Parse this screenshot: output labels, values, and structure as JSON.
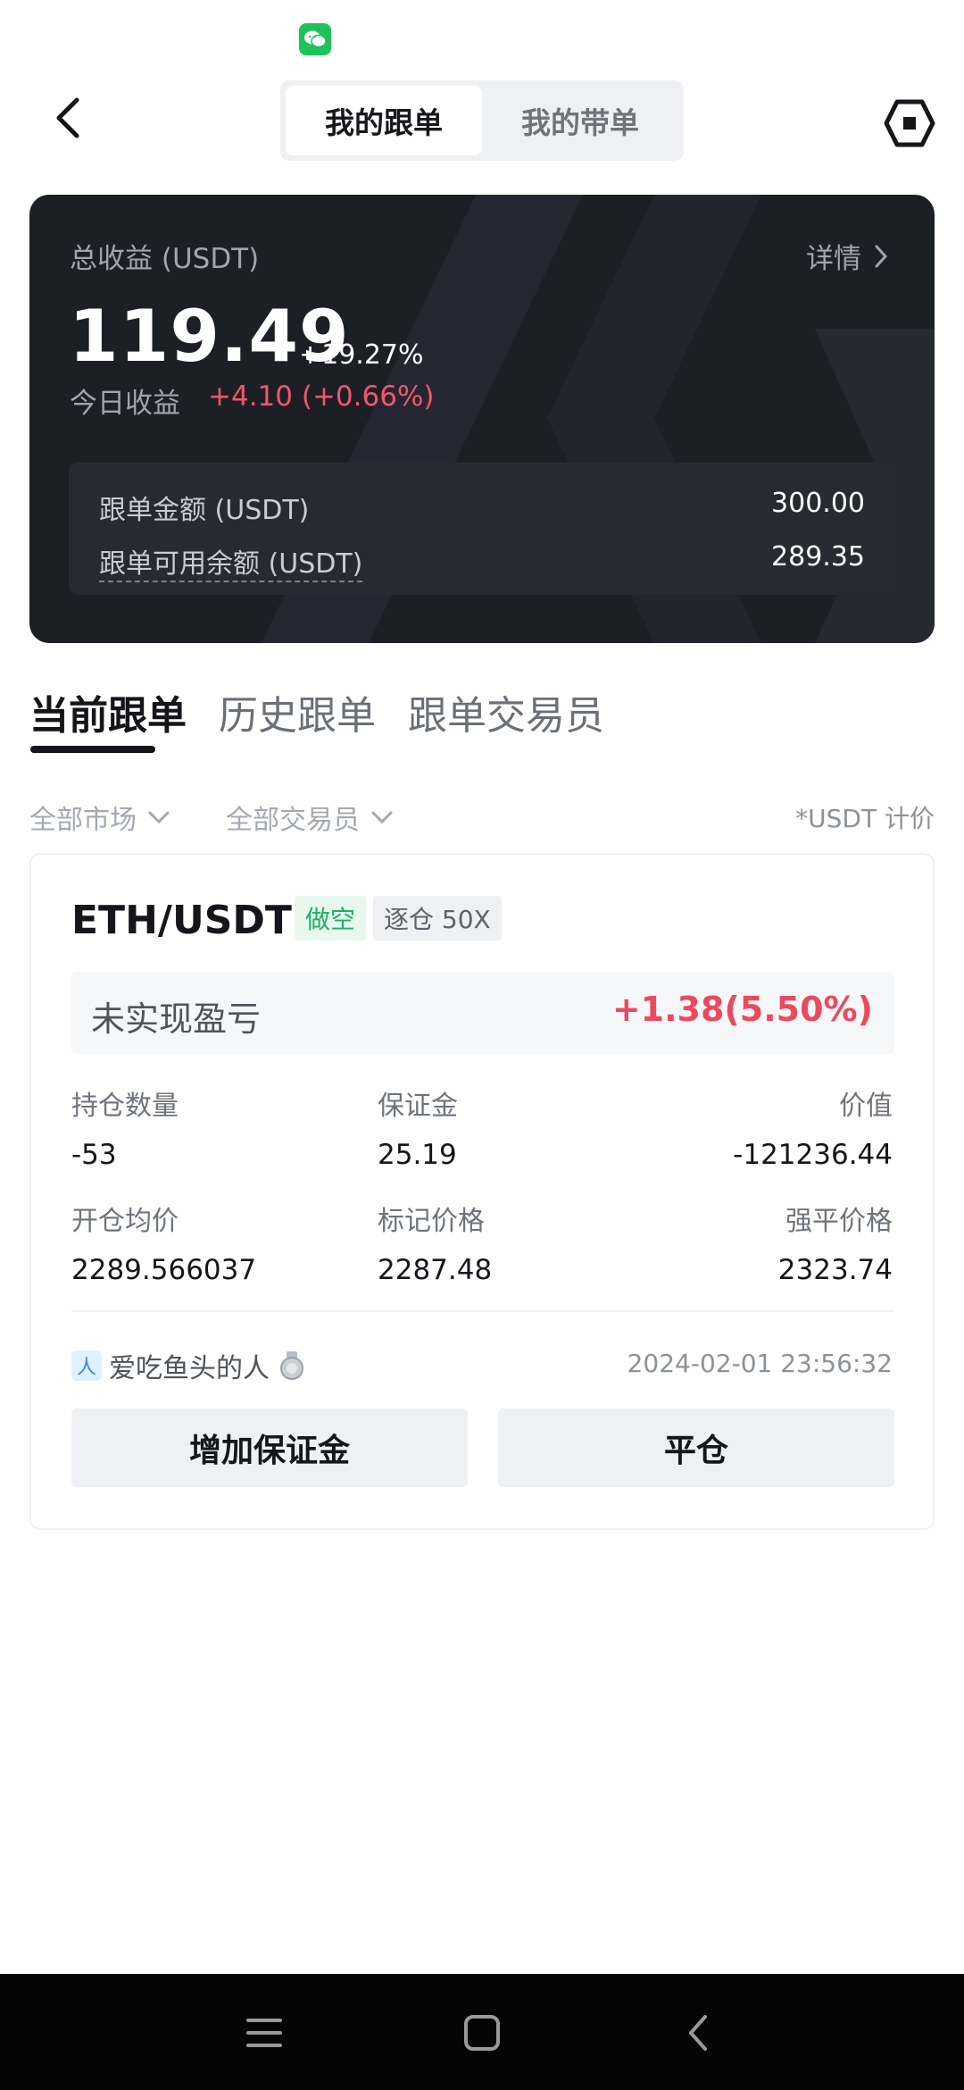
{
  "header": {
    "tabs": [
      {
        "label": "我的跟单",
        "active": true
      },
      {
        "label": "我的带单",
        "active": false
      }
    ]
  },
  "summary": {
    "label": "总收益 (USDT)",
    "detail_label": "详情",
    "total_value": "119.49",
    "total_percent": "+19.27%",
    "today_label": "今日收益",
    "today_value": "+4.10 (+0.66%)",
    "copy_amount_label": "跟单金额 (USDT)",
    "copy_amount_value": "300.00",
    "available_label": "跟单可用余额 (USDT)",
    "available_value": "289.35"
  },
  "tabs": [
    {
      "label": "当前跟单",
      "active": true
    },
    {
      "label": "历史跟单",
      "active": false
    },
    {
      "label": "跟单交易员",
      "active": false
    }
  ],
  "filters": {
    "market": "全部市场",
    "trader": "全部交易员",
    "note": "*USDT 计价"
  },
  "position": {
    "pair": "ETH/USDT",
    "side": "做空",
    "leverage": "逐仓 50X",
    "pnl_label": "未实现盈亏",
    "pnl_value": "+1.38(5.50%)",
    "fields": [
      {
        "label": "持仓数量",
        "value": "-53"
      },
      {
        "label": "保证金",
        "value": "25.19"
      },
      {
        "label": "价值",
        "value": "-121236.44"
      },
      {
        "label": "开仓均价",
        "value": "2289.566037"
      },
      {
        "label": "标记价格",
        "value": "2287.48"
      },
      {
        "label": "强平价格",
        "value": "2323.74"
      }
    ],
    "trader_name": "爱吃鱼头的人",
    "timestamp": "2024-02-01 23:56:32",
    "add_margin_label": "增加保证金",
    "close_label": "平仓"
  },
  "colors": {
    "profit_red": "#eb4a5e",
    "short_green": "#1eb163",
    "card_dark": "#1d1f27"
  },
  "icons": [
    "wechat-icon",
    "back-icon",
    "hexagon-icon",
    "chevron-right-icon",
    "chevron-down-icon",
    "medal-icon",
    "menu-icon",
    "home-icon",
    "back-nav-icon"
  ]
}
